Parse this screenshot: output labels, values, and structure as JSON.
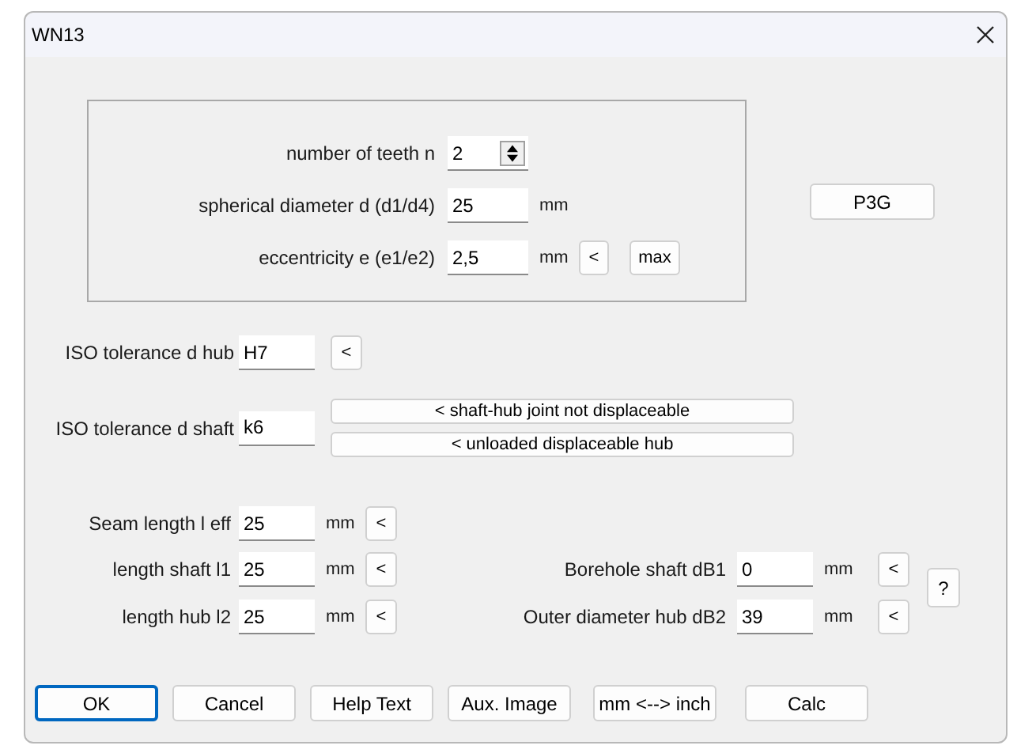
{
  "window": {
    "title": "WN13"
  },
  "group": {
    "rows": [
      {
        "kind": "spinner",
        "label": "number of teeth n",
        "value": "2"
      },
      {
        "kind": "field",
        "label": "spherical diameter d (d1/d4)",
        "value": "25",
        "unit": "mm"
      },
      {
        "kind": "field",
        "label": "eccentricity e (e1/e2)",
        "value": "2,5",
        "unit": "mm",
        "buttons": [
          "<",
          "max"
        ]
      }
    ]
  },
  "side_button": "P3G",
  "tolerances": [
    {
      "label": "ISO tolerance d hub",
      "value": "H7",
      "buttons": [
        "<"
      ]
    },
    {
      "label": "ISO tolerance d shaft",
      "value": "k6",
      "buttons": [
        "< shaft-hub joint not displaceable",
        "< unloaded displaceable hub"
      ]
    }
  ],
  "seam": {
    "label": "Seam length l eff",
    "value": "25",
    "unit": "mm",
    "button": "<"
  },
  "lengths_left": [
    {
      "label": "length shaft l1",
      "value": "25",
      "unit": "mm",
      "button": "<"
    },
    {
      "label": "length hub l2",
      "value": "25",
      "unit": "mm",
      "button": "<"
    }
  ],
  "lengths_right": [
    {
      "label": "Borehole shaft dB1",
      "value": "0",
      "unit": "mm",
      "button": "<"
    },
    {
      "label": "Outer diameter hub dB2",
      "value": "39",
      "unit": "mm",
      "button": "<"
    }
  ],
  "help_button": "?",
  "buttons": [
    {
      "label": "OK",
      "default": true
    },
    {
      "label": "Cancel",
      "default": false
    },
    {
      "label": "Help Text",
      "default": false
    },
    {
      "label": "Aux. Image",
      "default": false
    },
    {
      "label": "mm <--> inch",
      "default": false
    },
    {
      "label": "Calc",
      "default": false
    }
  ]
}
